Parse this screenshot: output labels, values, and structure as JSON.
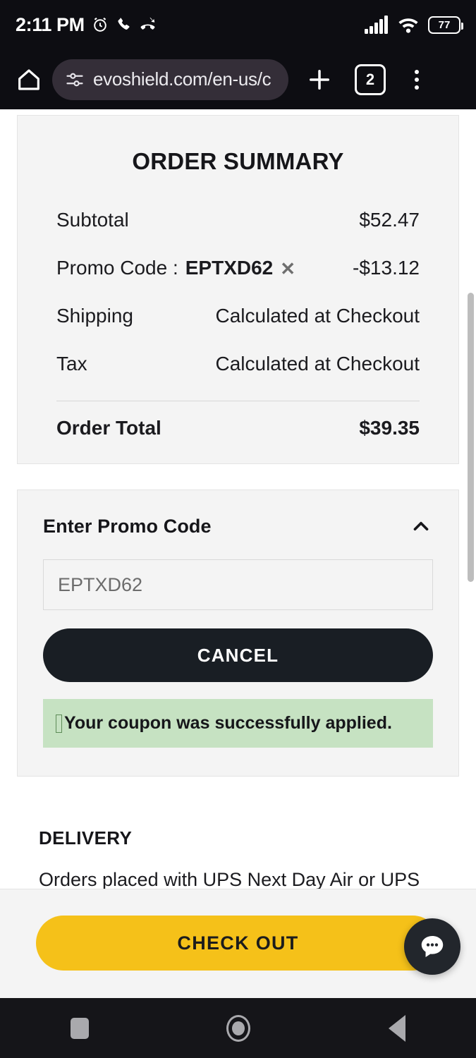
{
  "status_bar": {
    "time": "2:11 PM",
    "battery_percent": "77",
    "icons": [
      "alarm-clock-icon",
      "phone-call-icon",
      "missed-call-icon",
      "cellular-signal-icon",
      "wifi-icon",
      "battery-icon"
    ]
  },
  "browser": {
    "url": "evoshield.com/en-us/c",
    "tab_count": "2",
    "home_icon": "home-icon",
    "site_settings_icon": "tune-sliders-icon",
    "new_tab_icon": "plus-icon",
    "menu_icon": "overflow-menu-icon"
  },
  "order_summary": {
    "title": "ORDER SUMMARY",
    "rows": [
      {
        "label": "Subtotal",
        "value": "$52.47"
      },
      {
        "label": "Promo Code :",
        "code": "EPTXD62",
        "value": "-$13.12",
        "remove_icon": "close-x-icon"
      },
      {
        "label": "Shipping",
        "value": "Calculated at Checkout"
      },
      {
        "label": "Tax",
        "value": "Calculated at Checkout"
      }
    ],
    "total_label": "Order Total",
    "total_value": "$39.35"
  },
  "promo_section": {
    "heading": "Enter Promo Code",
    "collapse_icon": "chevron-up-icon",
    "input_value": "EPTXD62",
    "input_placeholder": "EPTXD62",
    "cancel_label": "CANCEL",
    "success_message": "Your coupon was successfully applied.",
    "success_bg": "#c6e2c2"
  },
  "delivery": {
    "heading": "DELIVERY",
    "body": "Orders placed with UPS Next Day Air or UPS Second Day Air will ship the next"
  },
  "checkout": {
    "label": "CHECK OUT",
    "accent": "#f5c119",
    "chat_icon": "chat-bubble-icon"
  },
  "android_nav": {
    "recents": "recents-square-icon",
    "home": "home-circle-icon",
    "back": "back-triangle-icon"
  }
}
